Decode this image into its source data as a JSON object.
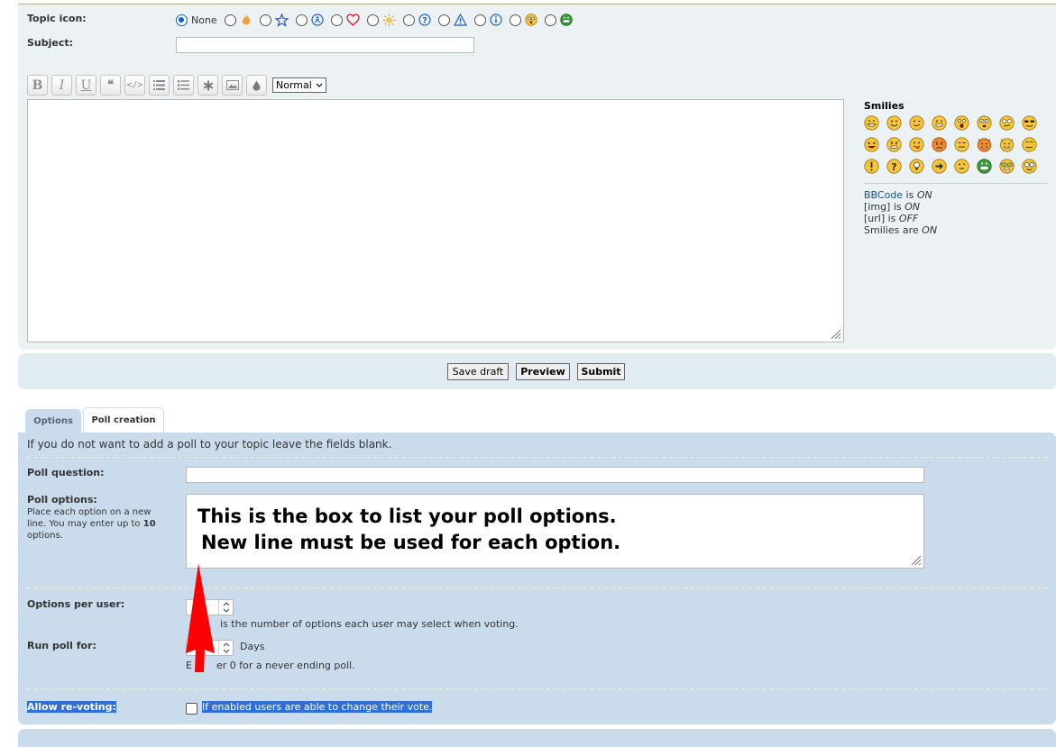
{
  "post": {
    "topic_icon_label": "Topic icon:",
    "topic_icon_none": "None",
    "subject_label": "Subject:",
    "subject_value": ""
  },
  "toolbar": {
    "bold": "B",
    "italic": "I",
    "underline": "U",
    "quote": "❝",
    "code": "</>",
    "font_size": "Normal"
  },
  "smilies": {
    "heading": "Smilies",
    "bbcode_link": "BBCode",
    "is": " is ",
    "bbcode_state": "ON",
    "img_label": "[img] is ",
    "img_state": "ON",
    "url_label": "[url] is ",
    "url_state": "OFF",
    "smilies_label": "Smilies are ",
    "smilies_state": "ON"
  },
  "buttons": {
    "save_draft": "Save draft",
    "preview": "Preview",
    "submit": "Submit"
  },
  "tabs": {
    "options": "Options",
    "poll_creation": "Poll creation"
  },
  "poll": {
    "intro": "If you do not want to add a poll to your topic leave the fields blank.",
    "question_label": "Poll question:",
    "question_value": "",
    "options_label": "Poll options:",
    "options_hint_1": "Place each option on a new",
    "options_hint_2": "line. You may enter up to",
    "options_hint_max": "10",
    "options_hint_3": "options.",
    "annotation_line1": "This is the box to list your poll options.",
    "annotation_line2": "New line must be used for each option.",
    "per_user_label": "Options per user:",
    "per_user_hint": "is the number of options each user may select when voting.",
    "run_for_label": "Run poll for:",
    "days_label": "Days",
    "run_for_hint_pre": "E",
    "run_for_hint": "er 0 for a never ending poll.",
    "revote_label": "Allow re-voting:",
    "revote_hint": "If enabled users are able to change their vote."
  },
  "colors": {
    "accent": "#0a64c8",
    "annotation_arrow": "#ff0000",
    "selection": "#2f6fd6"
  }
}
